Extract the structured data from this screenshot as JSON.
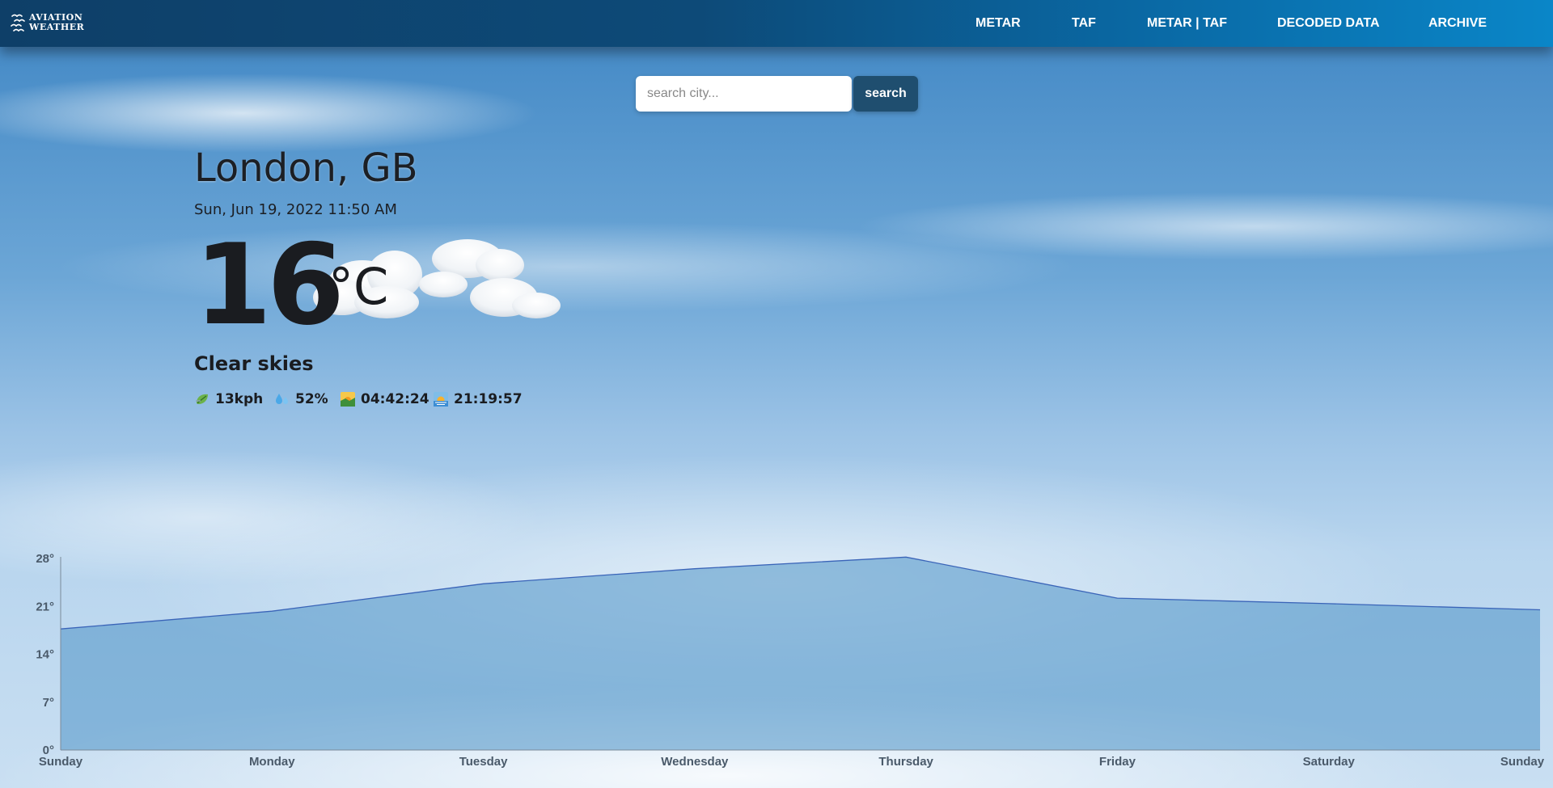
{
  "header": {
    "logo_line1": "AVIATION",
    "logo_line2": "WEATHER",
    "nav": [
      {
        "label": "METAR"
      },
      {
        "label": "TAF"
      },
      {
        "label": "METAR | TAF"
      },
      {
        "label": "DECODED DATA"
      },
      {
        "label": "ARCHIVE"
      }
    ]
  },
  "search": {
    "placeholder": "search city...",
    "value": "",
    "button_label": "search"
  },
  "weather": {
    "city": "London, GB",
    "datetime": "Sun, Jun 19, 2022 11:50 AM",
    "temperature": "16",
    "unit": "°C",
    "condition": "Clear skies",
    "condition_icon": "cloud-icon",
    "stats": {
      "wind": "13kph",
      "humidity": "52%",
      "sunrise": "04:42:24",
      "sunset": "21:19:57"
    }
  },
  "colors": {
    "header_start": "#0e3f68",
    "header_end": "#0a86c8",
    "search_button": "#1f4e6f",
    "chart_fill": "#4f93c7",
    "chart_line": "#3a64b8"
  },
  "chart_data": {
    "type": "area",
    "categories": [
      "Sunday",
      "Monday",
      "Tuesday",
      "Wednesday",
      "Thursday",
      "Friday",
      "Saturday",
      "Sunday"
    ],
    "values": [
      17.7,
      20.3,
      24.3,
      26.5,
      28.2,
      22.2,
      21.4,
      20.5
    ],
    "y_ticks": [
      "0°",
      "7°",
      "14°",
      "21°",
      "28°"
    ],
    "ylim": [
      0,
      28
    ],
    "xlabel": "",
    "ylabel": "",
    "legend": "none",
    "grid": false
  }
}
